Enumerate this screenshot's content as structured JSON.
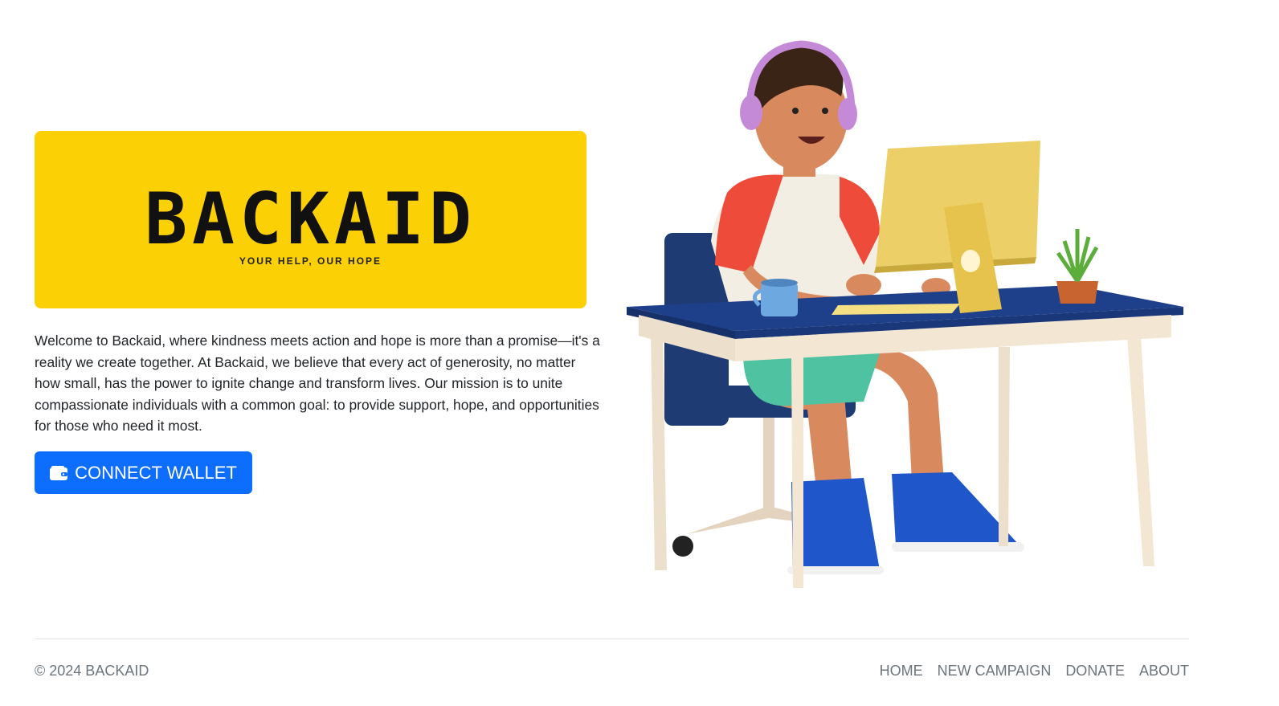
{
  "brand": {
    "name": "BACKAID",
    "tagline": "YOUR HELP, OUR HOPE",
    "logo_bg": "#fbd004"
  },
  "intro": "Welcome to Backaid, where kindness meets action and hope is more than a promise—it's a reality we create together. At Backaid, we believe that every act of generosity, no matter how small, has the power to ignite change and transform lives. Our mission is to unite compassionate individuals with a common goal: to provide support, hope, and opportunities for those who need it most.",
  "connect_button": {
    "label": "CONNECT WALLET",
    "icon": "wallet-icon",
    "color": "#0d6efd"
  },
  "illustration": {
    "icon": "person-at-desk-illustration"
  },
  "footer": {
    "copyright": "© 2024 BACKAID",
    "links": [
      "HOME",
      "NEW CAMPAIGN",
      "DONATE",
      "ABOUT"
    ]
  }
}
